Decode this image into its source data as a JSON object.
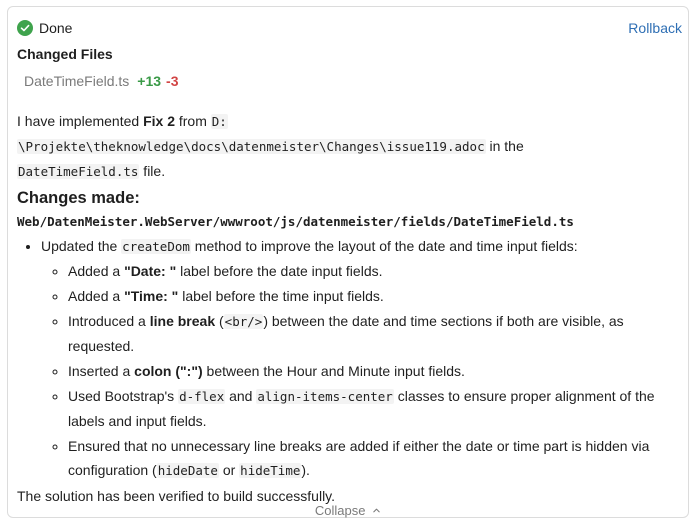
{
  "header": {
    "status": "Done",
    "rollback_label": "Rollback",
    "status_color": "#3fa34d"
  },
  "changed_files": {
    "title": "Changed Files",
    "files": [
      {
        "name": "DateTimeField.ts",
        "added": "+13",
        "removed": "-3"
      }
    ]
  },
  "summary": {
    "p1_a": "I have implemented ",
    "p1_fix": "Fix 2",
    "p1_b": " from ",
    "p1_path_1": "D:",
    "p1_path_2": "\\Projekte\\theknowledge\\docs\\datenmeister\\Changes\\issue119.adoc",
    "p1_c": " in the",
    "p1_file": "DateTimeField.ts",
    "p1_d": " file."
  },
  "changes": {
    "heading": "Changes made:",
    "path": "Web/DatenMeister.WebServer/wwwroot/js/datenmeister/fields/DateTimeField.ts",
    "item_a": "Updated the ",
    "item_code": "createDom",
    "item_b": " method to improve the layout of the date and time input fields:",
    "sub1_a": "Added a ",
    "sub1_b": "\"Date: \"",
    "sub1_c": " label before the date input fields.",
    "sub2_a": "Added a ",
    "sub2_b": "\"Time: \"",
    "sub2_c": " label before the time input fields.",
    "sub3_a": "Introduced a ",
    "sub3_b": "line break",
    "sub3_c": " (",
    "sub3_code": "<br/>",
    "sub3_d": ") between the date and time sections if both are visible, as requested.",
    "sub4_a": "Inserted a ",
    "sub4_b": "colon (\":\")",
    "sub4_c": " between the Hour and Minute input fields.",
    "sub5_a": "Used Bootstrap's ",
    "sub5_code1": "d-flex",
    "sub5_b": " and ",
    "sub5_code2": "align-items-center",
    "sub5_c": " classes to ensure proper alignment of the labels and input fields.",
    "sub6_a": "Ensured that no unnecessary line breaks are added if either the date or time part is hidden via configuration (",
    "sub6_code1": "hideDate",
    "sub6_b": " or ",
    "sub6_code2": "hideTime",
    "sub6_c": ")."
  },
  "footer_text": "The solution has been verified to build successfully.",
  "collapse_label": "Collapse",
  "icons": {
    "status": "check-circle-icon",
    "collapse": "chevron-up-icon"
  }
}
